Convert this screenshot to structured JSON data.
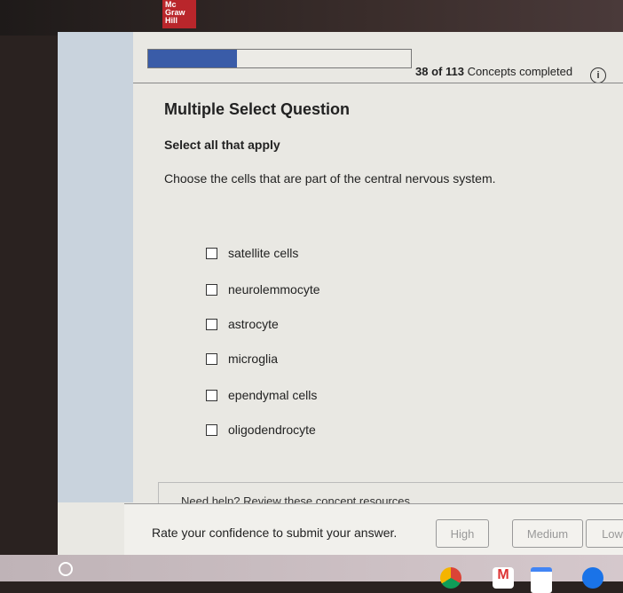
{
  "brand": {
    "logo_text": "Mc Graw Hill"
  },
  "progress": {
    "completed": 38,
    "total": 113,
    "text_count": "38 of 113",
    "text_suffix": "Concepts completed",
    "fraction": 0.336
  },
  "question": {
    "type_title": "Multiple Select Question",
    "instruction": "Select all that apply",
    "prompt": "Choose the cells that are part of the central nervous system.",
    "options": [
      {
        "label": "satellite cells",
        "checked": false
      },
      {
        "label": "neurolemmocyte",
        "checked": false
      },
      {
        "label": "astrocyte",
        "checked": false
      },
      {
        "label": "microglia",
        "checked": false
      },
      {
        "label": "ependymal cells",
        "checked": false
      },
      {
        "label": "oligodendrocyte",
        "checked": false
      }
    ]
  },
  "help": {
    "text": "Need help? Review these concept resources."
  },
  "confidence": {
    "prompt": "Rate your confidence to submit your answer.",
    "buttons": [
      "High",
      "Medium",
      "Low"
    ]
  },
  "colors": {
    "progress_fill": "#3a5ca8",
    "logo_red": "#b9262b"
  },
  "taskbar": {
    "icons": [
      "launcher-icon",
      "chrome-icon",
      "gmail-icon",
      "calendar-icon",
      "files-icon"
    ]
  }
}
